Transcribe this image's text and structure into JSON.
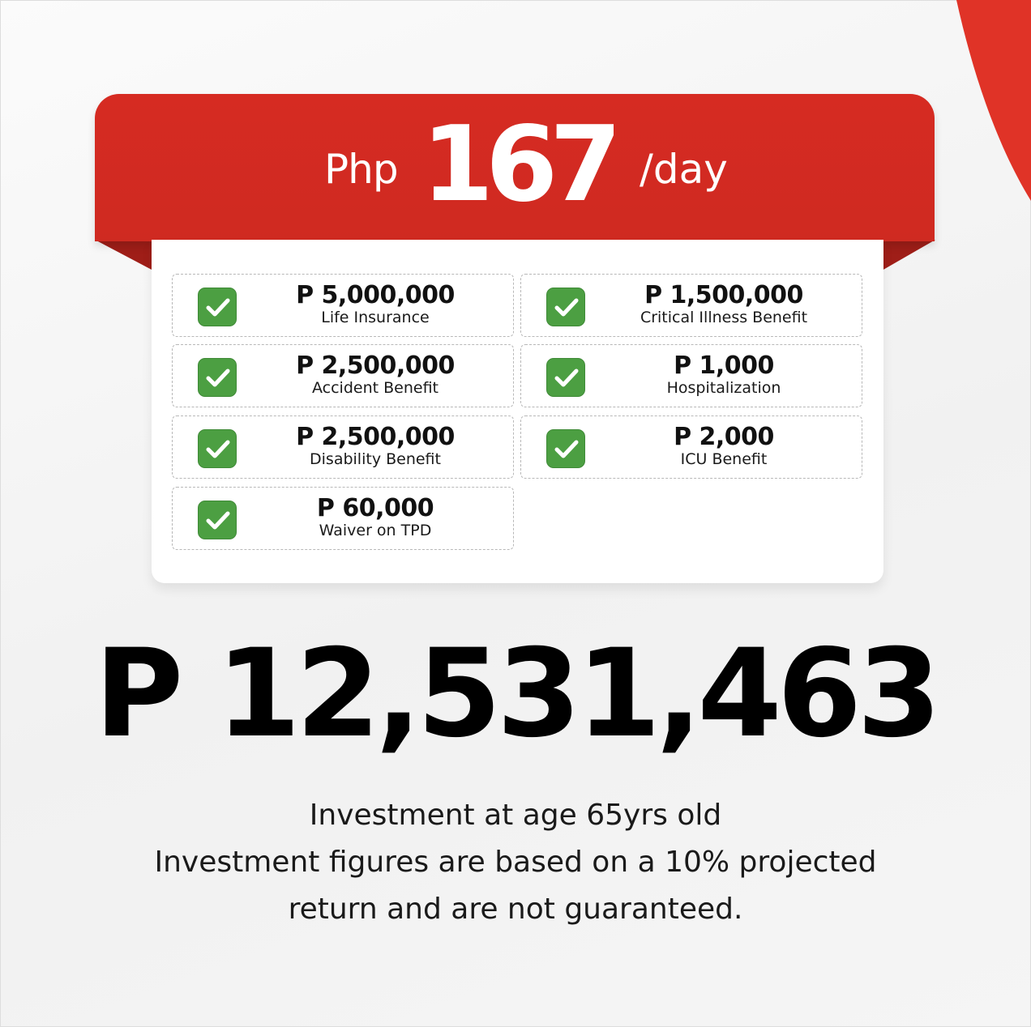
{
  "colors": {
    "banner_red": "#d62b22",
    "check_green": "#4c9f42",
    "text_dark": "#111111"
  },
  "header": {
    "currency": "Php",
    "amount": "167",
    "unit": "/day"
  },
  "benefits": [
    {
      "amount": "P 5,000,000",
      "label": "Life Insurance",
      "icon": "check-icon"
    },
    {
      "amount": "P 1,500,000",
      "label": "Critical Illness Benefit",
      "icon": "check-icon"
    },
    {
      "amount": "P 2,500,000",
      "label": "Accident Benefit",
      "icon": "check-icon"
    },
    {
      "amount": "P 1,000",
      "label": "Hospitalization",
      "icon": "check-icon"
    },
    {
      "amount": "P 2,500,000",
      "label": "Disability Benefit",
      "icon": "check-icon"
    },
    {
      "amount": "P 2,000",
      "label": "ICU Benefit",
      "icon": "check-icon"
    },
    {
      "amount": "P 60,000",
      "label": "Waiver on TPD",
      "icon": "check-icon"
    }
  ],
  "projection": {
    "total": "P 12,531,463",
    "line1": "Investment at age 65yrs old",
    "line2": "Investment figures are based on a 10% projected",
    "line3": "return and are not guaranteed."
  }
}
